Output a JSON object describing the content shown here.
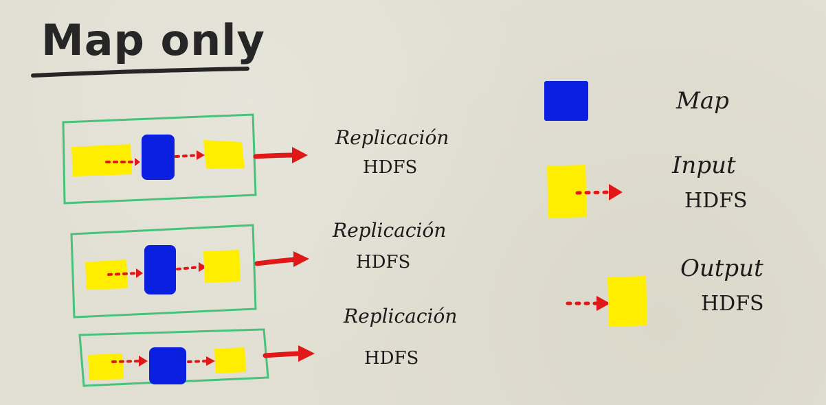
{
  "title": "Map only",
  "colors": {
    "background": "#e1dfd2",
    "map": "#0b1fe0",
    "data": "#ffee00",
    "arrow": "#e01818",
    "box": "#46c27a",
    "ink": "#1b1b1b"
  },
  "rows": [
    {
      "label_line1": "Replicación",
      "label_line2": "HDFS"
    },
    {
      "label_line1": "Replicación",
      "label_line2": "HDFS"
    },
    {
      "label_line1": "Replicación",
      "label_line2": "HDFS"
    }
  ],
  "legend": {
    "map": {
      "label": "Map"
    },
    "input": {
      "label_line1": "Input",
      "label_line2": "HDFS"
    },
    "output": {
      "label_line1": "Output",
      "label_line2": "HDFS"
    }
  }
}
